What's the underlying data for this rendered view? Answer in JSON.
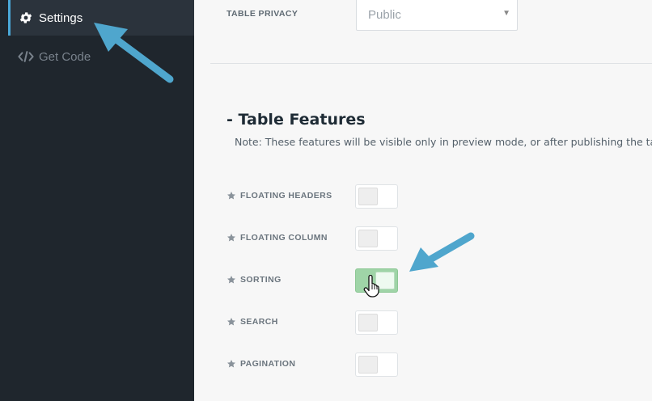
{
  "sidebar": {
    "items": [
      {
        "label": "Settings",
        "icon": "gear-icon",
        "active": true
      },
      {
        "label": "Get Code",
        "icon": "code-icon",
        "active": false
      }
    ]
  },
  "privacy": {
    "label": "TABLE PRIVACY",
    "value": "Public"
  },
  "features": {
    "title": "- Table Features",
    "note": "Note: These features will be visible only in preview mode, or after publishing the table.",
    "items": [
      {
        "label": "FLOATING HEADERS",
        "enabled": false
      },
      {
        "label": "FLOATING COLUMN",
        "enabled": false
      },
      {
        "label": "SORTING",
        "enabled": true
      },
      {
        "label": "SEARCH",
        "enabled": false
      },
      {
        "label": "PAGINATION",
        "enabled": false
      }
    ]
  },
  "colors": {
    "sidebar_bg": "#1f262d",
    "accent": "#4aa8d8",
    "toggle_on": "#9fd4a7",
    "annotation_arrow": "#4fa6cd"
  }
}
